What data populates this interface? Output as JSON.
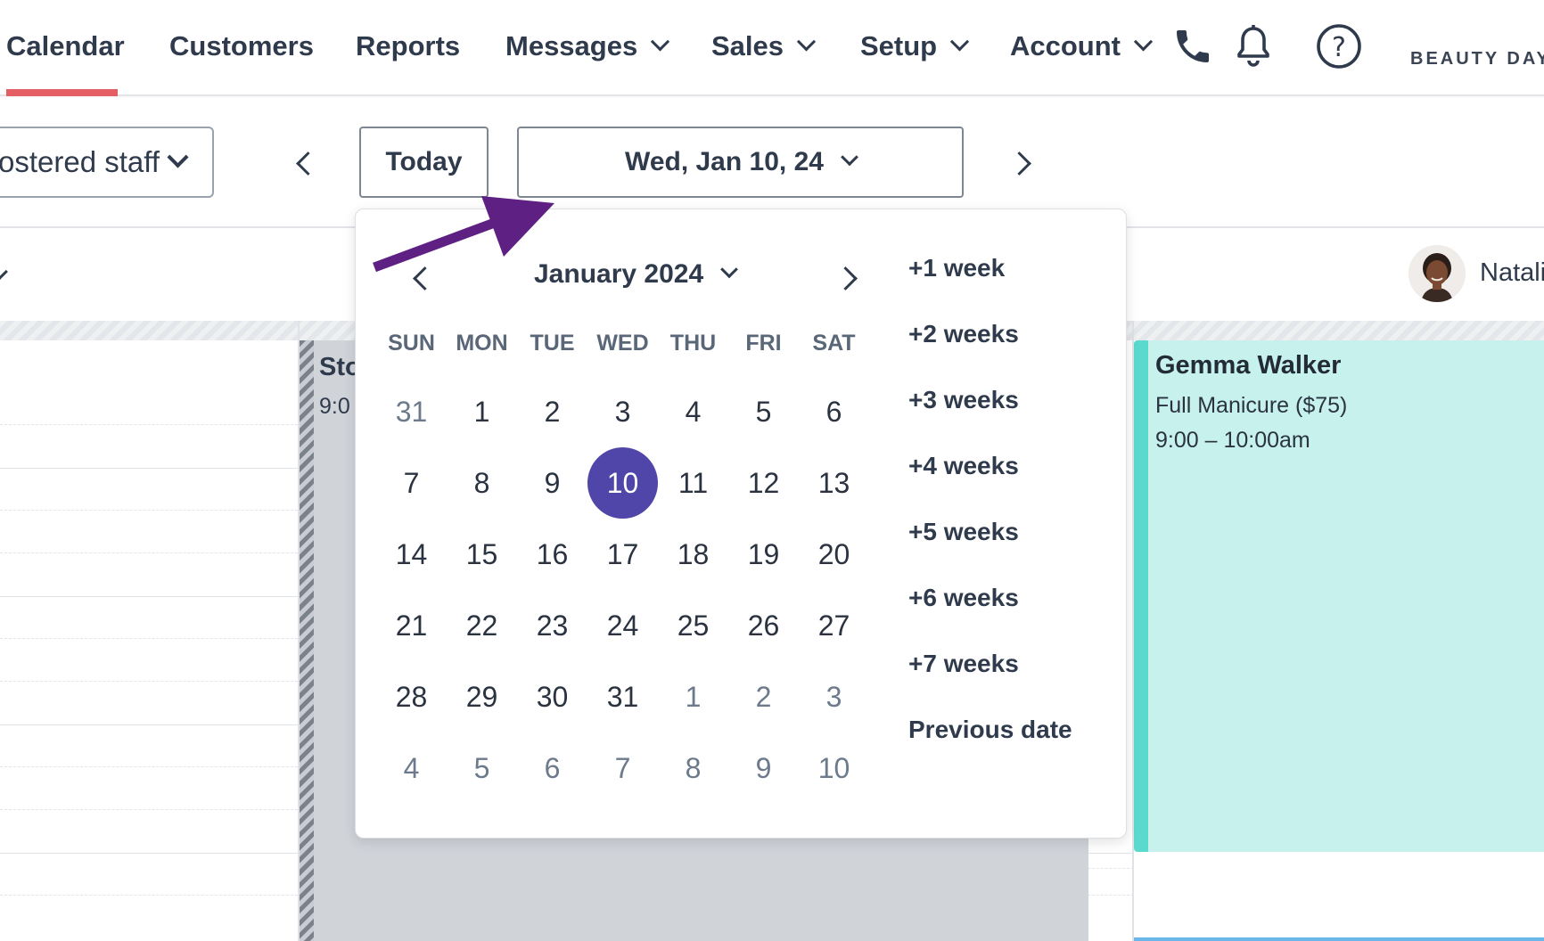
{
  "nav": {
    "items": [
      {
        "label": "Calendar",
        "dropdown": false,
        "active": true
      },
      {
        "label": "Customers",
        "dropdown": false
      },
      {
        "label": "Reports",
        "dropdown": false
      },
      {
        "label": "Messages",
        "dropdown": true
      },
      {
        "label": "Sales",
        "dropdown": true
      },
      {
        "label": "Setup",
        "dropdown": true
      },
      {
        "label": "Account",
        "dropdown": true
      }
    ],
    "icons": [
      "phone-icon",
      "bell-icon",
      "help-icon"
    ],
    "brand": "BEAUTY DAY S"
  },
  "toolbar": {
    "staff_select": "ostered staff",
    "today_label": "Today",
    "date_label": "Wed, Jan 10, 24"
  },
  "staff": {
    "name": "Natali"
  },
  "blocked": {
    "title": "Sto",
    "time": "9:0"
  },
  "appointment": {
    "customer": "Gemma Walker",
    "service": "Full Manicure ($75)",
    "time": "9:00 – 10:00am"
  },
  "datepicker": {
    "month_label": "January 2024",
    "weekdays": [
      "SUN",
      "MON",
      "TUE",
      "WED",
      "THU",
      "FRI",
      "SAT"
    ],
    "weeks": [
      [
        {
          "d": "31",
          "o": true
        },
        {
          "d": "1"
        },
        {
          "d": "2"
        },
        {
          "d": "3"
        },
        {
          "d": "4"
        },
        {
          "d": "5"
        },
        {
          "d": "6"
        }
      ],
      [
        {
          "d": "7"
        },
        {
          "d": "8"
        },
        {
          "d": "9"
        },
        {
          "d": "10",
          "sel": true
        },
        {
          "d": "11"
        },
        {
          "d": "12"
        },
        {
          "d": "13"
        }
      ],
      [
        {
          "d": "14"
        },
        {
          "d": "15"
        },
        {
          "d": "16"
        },
        {
          "d": "17"
        },
        {
          "d": "18"
        },
        {
          "d": "19"
        },
        {
          "d": "20"
        }
      ],
      [
        {
          "d": "21"
        },
        {
          "d": "22"
        },
        {
          "d": "23"
        },
        {
          "d": "24"
        },
        {
          "d": "25"
        },
        {
          "d": "26"
        },
        {
          "d": "27"
        }
      ],
      [
        {
          "d": "28"
        },
        {
          "d": "29"
        },
        {
          "d": "30"
        },
        {
          "d": "31"
        },
        {
          "d": "1",
          "o": true
        },
        {
          "d": "2",
          "o": true
        },
        {
          "d": "3",
          "o": true
        }
      ],
      [
        {
          "d": "4",
          "o": true
        },
        {
          "d": "5",
          "o": true
        },
        {
          "d": "6",
          "o": true
        },
        {
          "d": "7",
          "o": true
        },
        {
          "d": "8",
          "o": true
        },
        {
          "d": "9",
          "o": true
        },
        {
          "d": "10",
          "o": true
        }
      ]
    ],
    "quick_links": [
      "+1 week",
      "+2 weeks",
      "+3 weeks",
      "+4 weeks",
      "+5 weeks",
      "+6 weeks",
      "+7 weeks",
      "Previous date"
    ]
  },
  "colors": {
    "accent_underline": "#e35f64",
    "selected_day": "#5045a8",
    "appointment_bg": "#c6f1ec",
    "appointment_border": "#5ad9cd",
    "annotation_arrow": "#5e2183"
  }
}
